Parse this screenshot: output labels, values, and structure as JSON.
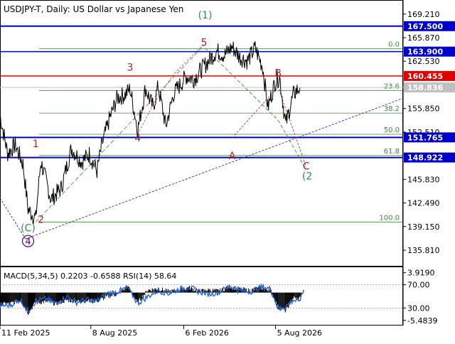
{
  "header": {
    "title": "USDJPY-T, Daily:  US Dollar vs Japanese Yen"
  },
  "chart_data": [
    {
      "type": "line",
      "title": "USDJPY-T, Daily:  US Dollar vs Japanese Yen",
      "ylim": [
        133.5,
        171.2
      ],
      "y_ticks": [
        "169.210",
        "165.870",
        "162.530",
        "155.850",
        "152.510",
        "145.830",
        "142.490",
        "139.150",
        "135.810"
      ],
      "x_ticks": [
        {
          "label": "11 Feb 2025",
          "t": 0
        },
        {
          "label": "8 Aug 2025",
          "t": 178
        },
        {
          "label": "6 Feb 2026",
          "t": 360
        },
        {
          "label": "5 Aug 2026",
          "t": 540
        }
      ],
      "xlim": [
        0,
        790
      ],
      "series": [
        {
          "kind": "price",
          "color": "#000000",
          "x": [
            0,
            15,
            30,
            45,
            55,
            70,
            80,
            100,
            120,
            140,
            160,
            175,
            190,
            200,
            215,
            230,
            245,
            255,
            270,
            285,
            300,
            310,
            325,
            340,
            350,
            365,
            380,
            395,
            410,
            425,
            440,
            455,
            470,
            485,
            500,
            515,
            525,
            540,
            548,
            560,
            568,
            575,
            580,
            588
          ],
          "y": [
            154.9,
            149.5,
            150.7,
            148.0,
            141.6,
            140.3,
            148.4,
            143.0,
            144.6,
            150.2,
            148.3,
            149.4,
            147.0,
            150.8,
            154.5,
            157.4,
            157.8,
            158.6,
            152.8,
            158.7,
            156.0,
            159.0,
            153.3,
            157.9,
            158.9,
            160.4,
            160.0,
            161.4,
            162.7,
            164.0,
            163.4,
            164.6,
            163.1,
            162.6,
            164.4,
            161.7,
            156.0,
            159.8,
            160.3,
            153.6,
            155.9,
            157.8,
            158.3,
            158.8
          ]
        }
      ],
      "levels": [
        {
          "price": "167.500",
          "value": 167.5,
          "color": "#0000cc",
          "box": "#0000cc",
          "width": 2
        },
        {
          "price": "163.900",
          "value": 163.9,
          "color": "#0000cc",
          "box": "#0000cc",
          "width": 1.5
        },
        {
          "price": "160.455",
          "value": 160.455,
          "color": "#e00000",
          "box": "#e00000",
          "width": 1.5
        },
        {
          "price": "158.836",
          "value": 158.836,
          "color": "#c0c0c0",
          "box": "#c0c0c0",
          "width": 1
        },
        {
          "price": "151.765",
          "value": 151.765,
          "color": "#0000cc",
          "box": "#0000cc",
          "width": 2
        },
        {
          "price": "148.922",
          "value": 148.922,
          "color": "#0000cc",
          "box": "#0000cc",
          "width": 2
        }
      ],
      "fibonacci": [
        {
          "label": "0.0",
          "value": 164.3
        },
        {
          "label": "23.6",
          "value": 158.4
        },
        {
          "label": "38.2",
          "value": 155.2
        },
        {
          "label": "50.0",
          "value": 152.2
        },
        {
          "label": "61.8",
          "value": 149.2
        },
        {
          "label": "100.0",
          "value": 139.8
        }
      ],
      "wave_labels": [
        {
          "text": "1",
          "t": 70,
          "value": 150.4,
          "color": "#a52a2a"
        },
        {
          "text": "2",
          "t": 80,
          "value": 139.7,
          "color": "#a52a2a"
        },
        {
          "text": "3",
          "t": 255,
          "value": 161.2,
          "color": "#a52a2a"
        },
        {
          "text": "4",
          "t": 270,
          "value": 151.2,
          "color": "#a52a2a"
        },
        {
          "text": "5",
          "t": 400,
          "value": 164.7,
          "color": "#a52a2a"
        },
        {
          "text": "(1)",
          "t": 402,
          "value": 168.6,
          "color": "#2e8b57"
        },
        {
          "text": "(C)",
          "t": 55,
          "value": 138.5,
          "color": "#2e8b57"
        },
        {
          "text": "B",
          "t": 545,
          "value": 160.4,
          "color": "#a52a2a"
        },
        {
          "text": "A",
          "t": 455,
          "value": 148.7,
          "color": "#a52a2a"
        },
        {
          "text": "C",
          "t": 600,
          "value": 147.2,
          "color": "#a52a2a"
        },
        {
          "text": "(2",
          "t": 602,
          "value": 145.8,
          "color": "#2e8b57"
        }
      ],
      "circled_label": {
        "text": "4",
        "t": 55,
        "value": 136.6,
        "color": "#4b0082"
      }
    },
    {
      "type": "line",
      "title": "MACD(5,34,5) 0.2203 -0.6588 RSI(14) 58.64",
      "ylim": [
        -6.5,
        5.0
      ],
      "y_ticks": [
        "3.9190",
        "70.00",
        "30.00",
        "-5.4839"
      ],
      "series": [
        {
          "kind": "macd",
          "color": "#000000",
          "x": [
            0,
            20,
            40,
            55,
            70,
            90,
            110,
            130,
            150,
            170,
            190,
            210,
            230,
            250,
            270,
            290,
            310,
            330,
            350,
            370,
            390,
            410,
            430,
            450,
            470,
            490,
            510,
            530,
            545,
            560,
            575,
            585,
            595
          ],
          "y": [
            -2.3,
            -2.2,
            -1.5,
            -4.0,
            -2.0,
            -1.8,
            -2.2,
            -1.5,
            -1.7,
            -1.6,
            -1.7,
            -0.8,
            -0.3,
            1.2,
            -2.0,
            0.5,
            0.8,
            0.2,
            0.5,
            1.0,
            0.3,
            0.5,
            0.3,
            1.2,
            0.7,
            0.4,
            0.9,
            0.6,
            -3.0,
            -3.6,
            -1.0,
            -1.4,
            0.2
          ]
        },
        {
          "kind": "rsi",
          "color": "#1e5fd8",
          "x": [
            0,
            20,
            40,
            55,
            70,
            90,
            110,
            130,
            150,
            170,
            190,
            210,
            230,
            250,
            270,
            290,
            310,
            330,
            350,
            370,
            390,
            410,
            430,
            450,
            470,
            490,
            510,
            530,
            545,
            560,
            575,
            585,
            595
          ],
          "y": [
            34,
            35,
            45,
            25,
            42,
            46,
            38,
            50,
            40,
            44,
            42,
            55,
            58,
            65,
            38,
            50,
            60,
            55,
            62,
            66,
            58,
            54,
            57,
            68,
            59,
            58,
            66,
            63,
            30,
            33,
            44,
            40,
            58
          ]
        }
      ],
      "levels": [
        {
          "label": "70.00",
          "rsi_value": 70
        },
        {
          "label": "30.00",
          "rsi_value": 30
        }
      ]
    }
  ]
}
